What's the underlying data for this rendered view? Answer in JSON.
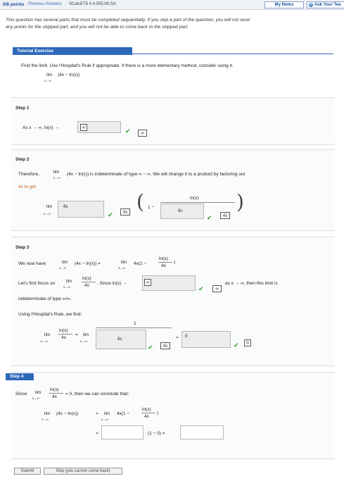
{
  "topbar": {
    "points": "0/8 points",
    "previous": "Previous Answers",
    "code": "SCalcET8 4.4.055.MI.SA",
    "my_notes": "My Notes",
    "ask": "Ask Your Tea"
  },
  "note": {
    "line1": "This question has several parts that must be completed sequentially. If you skip a part of the question, you will not recei",
    "line2": "any points for the skipped part, and you will not be able to come back to the skipped part."
  },
  "tutorial": {
    "title": "Tutorial Exercise",
    "prompt": "Find the limit. Use l'Hospital's Rule if appropriate. If there is a more elementary method, consider using it.",
    "lim": "lim",
    "expr": "(4x − ln(x))",
    "sub": "x→∞"
  },
  "step1": {
    "label": "Step 1",
    "text": "As x → ∞, ln(x) →",
    "answer": "∞",
    "correct": "∞"
  },
  "step2": {
    "label": "Step 2",
    "text_a": "Therefore,",
    "text_b": "(4x − ln(x)) is indeterminate of type ∞ − ∞. We will change it to a product by factoring out",
    "text_c": "4x to get",
    "lim": "lim",
    "sub": "x→∞",
    "answer_factor": "4x",
    "correct_factor": "4x",
    "one_minus": "1 −",
    "ln_label": "ln(x)",
    "answer_denom": "4x",
    "correct_denom": "4x"
  },
  "step3": {
    "label": "Step 3",
    "line1_a": "We now have",
    "line1_b": "(4x − ln(x)) =",
    "line1_c": "4x(1 −",
    "line1_frac_num": "ln(x)",
    "line1_frac_den": "4x",
    "line2_a": "Let's first focus on",
    "line2_frac_num": "ln(x)",
    "line2_frac_den": "4x",
    "line2_b": ". Since ln(x) →",
    "answer_inf": "∞",
    "correct_inf": "∞",
    "line2_c": "as x → ∞, then this limit is",
    "line3": "indeterminate of type ∞/∞.",
    "line4": "Using l'Hospital's Rule, we find:",
    "lim": "lim",
    "sub": "x→∞",
    "one": "1",
    "answer_den": "4x",
    "correct_den": "4x",
    "equals": "=",
    "answer_result": "0",
    "correct_result": "0"
  },
  "step4": {
    "label": "Step 4",
    "line1_a": "Since",
    "frac_num": "ln(x)",
    "frac_den": "4x",
    "line1_b": "= 0, then we can conclude that:",
    "lim": "lim",
    "sub": "x→∞",
    "expr": "(4x − ln(x))",
    "eq": "=",
    "rhs": "4x(1 −",
    "mid": "(1 − 0) =",
    "blank1": "",
    "blank2": ""
  },
  "buttons": {
    "submit": "Submit",
    "skip": "Skip (you cannot come back)"
  }
}
